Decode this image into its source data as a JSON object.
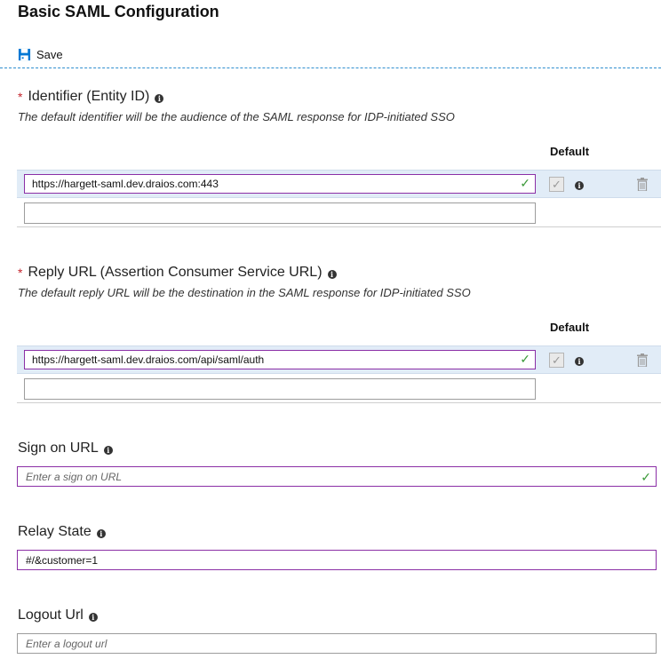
{
  "header": {
    "title": "Basic SAML Configuration"
  },
  "toolbar": {
    "save_label": "Save"
  },
  "identifier": {
    "label": "Identifier (Entity ID)",
    "required": "*",
    "description": "The default identifier will be the audience of the SAML response for IDP-initiated SSO",
    "default_header": "Default",
    "value": "https://hargett-saml.dev.draios.com:443",
    "default_checked": true
  },
  "reply_url": {
    "label": "Reply URL (Assertion Consumer Service URL)",
    "required": "*",
    "description": "The default reply URL will be the destination in the SAML response for IDP-initiated SSO",
    "default_header": "Default",
    "value": "https://hargett-saml.dev.draios.com/api/saml/auth",
    "default_checked": true
  },
  "sign_on_url": {
    "label": "Sign on URL",
    "placeholder": "Enter a sign on URL",
    "value": ""
  },
  "relay_state": {
    "label": "Relay State",
    "value": "#/&customer=1"
  },
  "logout_url": {
    "label": "Logout Url",
    "placeholder": "Enter a logout url",
    "value": ""
  },
  "colors": {
    "accent": "#0078d4",
    "input_border_active": "#8b2fa6",
    "valid_check": "#3c9a3a",
    "required": "#c4262e",
    "row_highlight": "#e1ecf7"
  },
  "icons": {
    "save": "save-icon",
    "info": "info-icon",
    "check": "check-icon",
    "trash": "trash-icon"
  }
}
